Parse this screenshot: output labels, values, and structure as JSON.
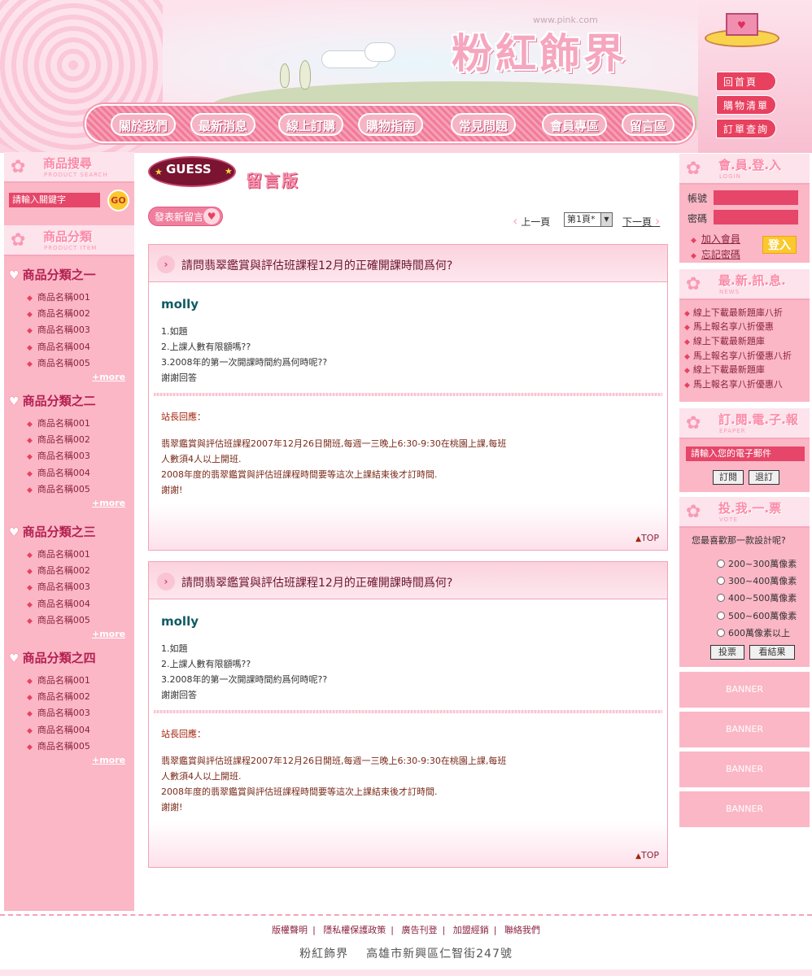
{
  "header": {
    "site_url": "www.pink.com",
    "site_title": "粉紅飾界",
    "nav": [
      "關於我們",
      "最新消息",
      "線上訂購",
      "購物指南",
      "常見問題",
      "會員專區",
      "留言區"
    ],
    "side_buttons": [
      "回首頁",
      "購物清單",
      "訂單查詢"
    ]
  },
  "search": {
    "title": "商品搜尋",
    "subtitle": "PRODUCT SEARCH",
    "placeholder": "請輸入關鍵字",
    "go_label": "GO"
  },
  "categories_panel": {
    "title": "商品分類",
    "subtitle": "PRODUCT ITEM",
    "more_label": "+more",
    "groups": [
      {
        "name": "商品分類之一",
        "items": [
          "商品名稱001",
          "商品名稱002",
          "商品名稱003",
          "商品名稱004",
          "商品名稱005"
        ]
      },
      {
        "name": "商品分類之二",
        "items": [
          "商品名稱001",
          "商品名稱002",
          "商品名稱003",
          "商品名稱004",
          "商品名稱005"
        ]
      },
      {
        "name": "商品分類之三",
        "items": [
          "商品名稱001",
          "商品名稱002",
          "商品名稱003",
          "商品名稱004",
          "商品名稱005"
        ]
      },
      {
        "name": "商品分類之四",
        "items": [
          "商品名稱001",
          "商品名稱002",
          "商品名稱003",
          "商品名稱004",
          "商品名稱005"
        ]
      }
    ]
  },
  "board": {
    "guess_label": "GUESS",
    "title": "留言版",
    "post_button": "發表新留言",
    "prev_label": "上一頁",
    "next_label": "下一頁",
    "page_value": "第1頁*"
  },
  "posts": [
    {
      "title": "請問翡翠鑑賞與評估班課程12月的正確開課時間爲何?",
      "author": "molly",
      "body": [
        "1.如題",
        "2.上課人數有限額嗎??",
        "3.2008年的第一次開課時間約爲何時呢??",
        "謝謝回答"
      ],
      "reply_label": "站長回應：",
      "reply": [
        "翡翠鑑賞與評估班課程2007年12月26日開班,每週一三晚上6:30-9:30在桃園上課,每班",
        "人數須4人以上開班.",
        "2008年度的翡翠鑑賞與評估班課程時間要等這次上課結束後才訂時間.",
        "謝謝!"
      ],
      "top_label": "TOP"
    },
    {
      "title": "請問翡翠鑑賞與評估班課程12月的正確開課時間爲何?",
      "author": "molly",
      "body": [
        "1.如題",
        "2.上課人數有限額嗎??",
        "3.2008年的第一次開課時間約爲何時呢??",
        "謝謝回答"
      ],
      "reply_label": "站長回應：",
      "reply": [
        "翡翠鑑賞與評估班課程2007年12月26日開班,每週一三晚上6:30-9:30在桃園上課,每班",
        "人數須4人以上開班.",
        "2008年度的翡翠鑑賞與評估班課程時間要等這次上課結束後才訂時間.",
        "謝謝!"
      ],
      "top_label": "TOP"
    }
  ],
  "login": {
    "title": "會.員.登.入",
    "subtitle": "LOGIN",
    "account_label": "帳號",
    "password_label": "密碼",
    "join_label": "加入會員",
    "forgot_label": "忘記密碼",
    "login_button": "登入"
  },
  "news": {
    "title": "最.新.訊.息.",
    "subtitle": "NEWS",
    "items": [
      "線上下載最新題庫八折",
      "馬上報名享八折優惠",
      "線上下載最新題庫",
      "馬上報名享八折優惠八折",
      "線上下載最新題庫",
      "馬上報名享八折優惠八"
    ]
  },
  "epaper": {
    "title": "訂.閱.電.子.報",
    "subtitle": "EPAPER",
    "placeholder": "請輸入您的電子郵件",
    "subscribe": "訂閱",
    "unsubscribe": "退訂"
  },
  "vote": {
    "title": "投.我.一.票",
    "subtitle": "VOTE",
    "question": "您最喜歡那一款設計呢?",
    "options": [
      "200~300萬像素",
      "300~400萬像素",
      "400~500萬像素",
      "500~600萬像素",
      "600萬像素以上"
    ],
    "vote_button": "投票",
    "result_button": "看結果"
  },
  "banners": [
    "BANNER",
    "BANNER",
    "BANNER",
    "BANNER"
  ],
  "footer": {
    "links": [
      "版權聲明",
      "隱私權保護政策",
      "廣告刊登",
      "加盟經銷",
      "聯絡我們"
    ],
    "company": "粉紅飾界",
    "address": "高雄市新興區仁智街247號"
  }
}
